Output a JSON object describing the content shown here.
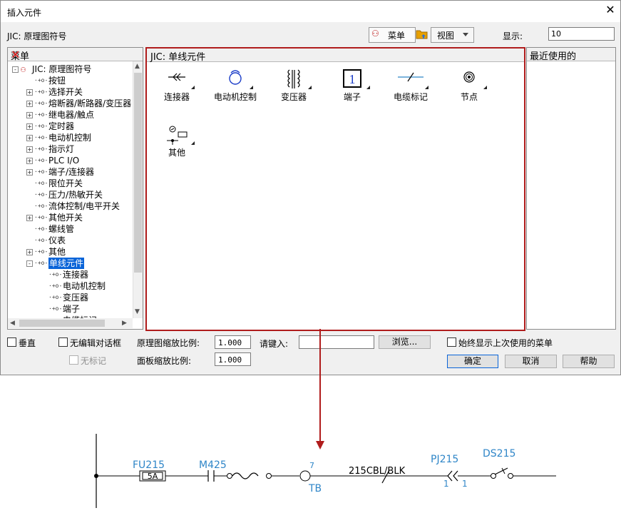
{
  "window": {
    "title": "插入元件",
    "close_icon": "close-icon"
  },
  "toolbar": {
    "library": "JIC: 原理图符号",
    "menu_button": "菜单",
    "view_button": "视图",
    "display_label": "显示:",
    "display_value": "10"
  },
  "menu_panel": {
    "header": "菜单",
    "tree": [
      {
        "label": "JIC: 原理图符号",
        "level": 0,
        "expander": "-",
        "icon": "symbol-library-icon"
      },
      {
        "label": "按钮",
        "level": 1,
        "expander": "",
        "icon": "component-icon"
      },
      {
        "label": "选择开关",
        "level": 1,
        "expander": "+",
        "icon": "component-icon"
      },
      {
        "label": "熔断器/断路器/变压器",
        "level": 1,
        "expander": "+",
        "icon": "component-icon"
      },
      {
        "label": "继电器/触点",
        "level": 1,
        "expander": "+",
        "icon": "component-icon"
      },
      {
        "label": "定时器",
        "level": 1,
        "expander": "+",
        "icon": "component-icon"
      },
      {
        "label": "电动机控制",
        "level": 1,
        "expander": "+",
        "icon": "component-icon"
      },
      {
        "label": "指示灯",
        "level": 1,
        "expander": "+",
        "icon": "component-icon"
      },
      {
        "label": "PLC I/O",
        "level": 1,
        "expander": "+",
        "icon": "component-icon"
      },
      {
        "label": "端子/连接器",
        "level": 1,
        "expander": "+",
        "icon": "component-icon"
      },
      {
        "label": "限位开关",
        "level": 1,
        "expander": "",
        "icon": "component-icon"
      },
      {
        "label": "压力/热敏开关",
        "level": 1,
        "expander": "",
        "icon": "component-icon"
      },
      {
        "label": "流体控制/电平开关",
        "level": 1,
        "expander": "",
        "icon": "component-icon"
      },
      {
        "label": "其他开关",
        "level": 1,
        "expander": "+",
        "icon": "component-icon"
      },
      {
        "label": "螺线管",
        "level": 1,
        "expander": "",
        "icon": "component-icon"
      },
      {
        "label": "仪表",
        "level": 1,
        "expander": "",
        "icon": "component-icon"
      },
      {
        "label": "其他",
        "level": 1,
        "expander": "+",
        "icon": "component-icon"
      },
      {
        "label": "单线元件",
        "level": 1,
        "expander": "-",
        "icon": "component-icon",
        "selected": true
      },
      {
        "label": "连接器",
        "level": 2,
        "expander": "",
        "icon": "component-icon"
      },
      {
        "label": "电动机控制",
        "level": 2,
        "expander": "",
        "icon": "component-icon"
      },
      {
        "label": "变压器",
        "level": 2,
        "expander": "",
        "icon": "component-icon"
      },
      {
        "label": "端子",
        "level": 2,
        "expander": "",
        "icon": "component-icon"
      },
      {
        "label": "电缆标记",
        "level": 2,
        "expander": "",
        "icon": "component-icon"
      }
    ]
  },
  "single_line_panel": {
    "header": "JIC: 单线元件",
    "items": [
      {
        "label": "连接器",
        "icon": "connector-icon"
      },
      {
        "label": "电动机控制",
        "icon": "motor-control-icon"
      },
      {
        "label": "变压器",
        "icon": "transformer-icon"
      },
      {
        "label": "端子",
        "icon": "terminal-icon",
        "glyph": "1"
      },
      {
        "label": "电缆标记",
        "icon": "cable-marker-icon"
      },
      {
        "label": "节点",
        "icon": "node-icon"
      },
      {
        "label": "其他",
        "icon": "other-icon"
      }
    ]
  },
  "recent_panel": {
    "header": "最近使用的"
  },
  "options": {
    "vertical": "垂直",
    "no_edit_dialog": "无编辑对话框",
    "no_tag": "无标记",
    "schematic_scale_label": "原理图缩放比例:",
    "schematic_scale_value": "1.000",
    "panel_scale_label": "面板缩放比例:",
    "panel_scale_value": "1.000",
    "enter_label": "请键入:",
    "enter_value": "",
    "browse_button": "浏览...",
    "always_show_last": "始终显示上次使用的菜单"
  },
  "buttons": {
    "ok": "确定",
    "cancel": "取消",
    "help": "帮助"
  },
  "schematic": {
    "fuse_tag": "FU215",
    "fuse_rating": "5A",
    "motor_tag": "M425",
    "terminal_number": "7",
    "terminal_strip": "TB",
    "cable_label": "215CBL/BLK",
    "connector_tag": "PJ215",
    "connector_pin_left": "1",
    "connector_pin_right": "1",
    "switch_tag": "DS215",
    "colors": {
      "blue": "#2f86c8",
      "red": "#b01c1c"
    }
  }
}
